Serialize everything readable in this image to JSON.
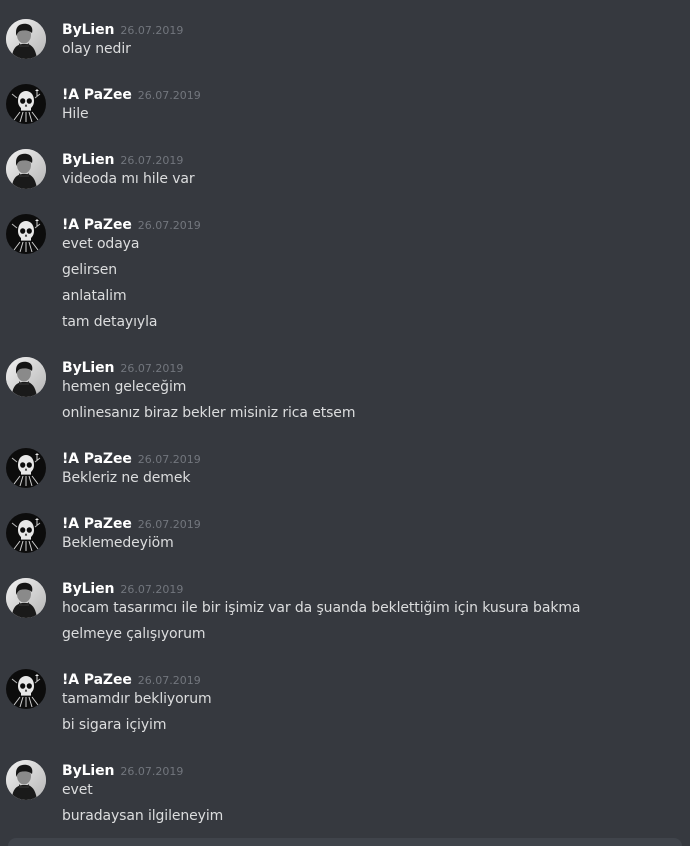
{
  "colors": {
    "background": "#36393f",
    "username": "#ffffff",
    "message_text": "#dcddde",
    "timestamp": "#72767d",
    "composer": "#40444b"
  },
  "users": {
    "bylien": {
      "name": "ByLien",
      "avatar_icon": "person-portrait-icon"
    },
    "pazee": {
      "name": "!A PaZee",
      "avatar_icon": "skull-icon"
    }
  },
  "groups": [
    {
      "author": "ByLien",
      "timestamp": "26.07.2019",
      "messages": [
        "olay nedir"
      ]
    },
    {
      "author": "!A PaZee",
      "timestamp": "26.07.2019",
      "messages": [
        "Hile"
      ]
    },
    {
      "author": "ByLien",
      "timestamp": "26.07.2019",
      "messages": [
        "videoda mı hile var"
      ]
    },
    {
      "author": "!A PaZee",
      "timestamp": "26.07.2019",
      "messages": [
        "evet odaya",
        "gelirsen",
        "anlatalim",
        "tam detayıyla"
      ]
    },
    {
      "author": "ByLien",
      "timestamp": "26.07.2019",
      "messages": [
        "hemen geleceğim",
        "onlinesanız biraz bekler misiniz rica etsem"
      ]
    },
    {
      "author": "!A PaZee",
      "timestamp": "26.07.2019",
      "messages": [
        "Bekleriz ne demek"
      ]
    },
    {
      "author": "!A PaZee",
      "timestamp": "26.07.2019",
      "messages": [
        "Beklemedeyiöm"
      ]
    },
    {
      "author": "ByLien",
      "timestamp": "26.07.2019",
      "messages": [
        "hocam tasarımcı ile bir işimiz var da şuanda beklettiğim için kusura bakma",
        "gelmeye çalışıyorum"
      ]
    },
    {
      "author": "!A PaZee",
      "timestamp": "26.07.2019",
      "messages": [
        "tamamdır bekliyorum",
        "bi sigara içiyim"
      ]
    },
    {
      "author": "ByLien",
      "timestamp": "26.07.2019",
      "messages": [
        "evet",
        "buradaysan ilgileneyim"
      ]
    }
  ]
}
